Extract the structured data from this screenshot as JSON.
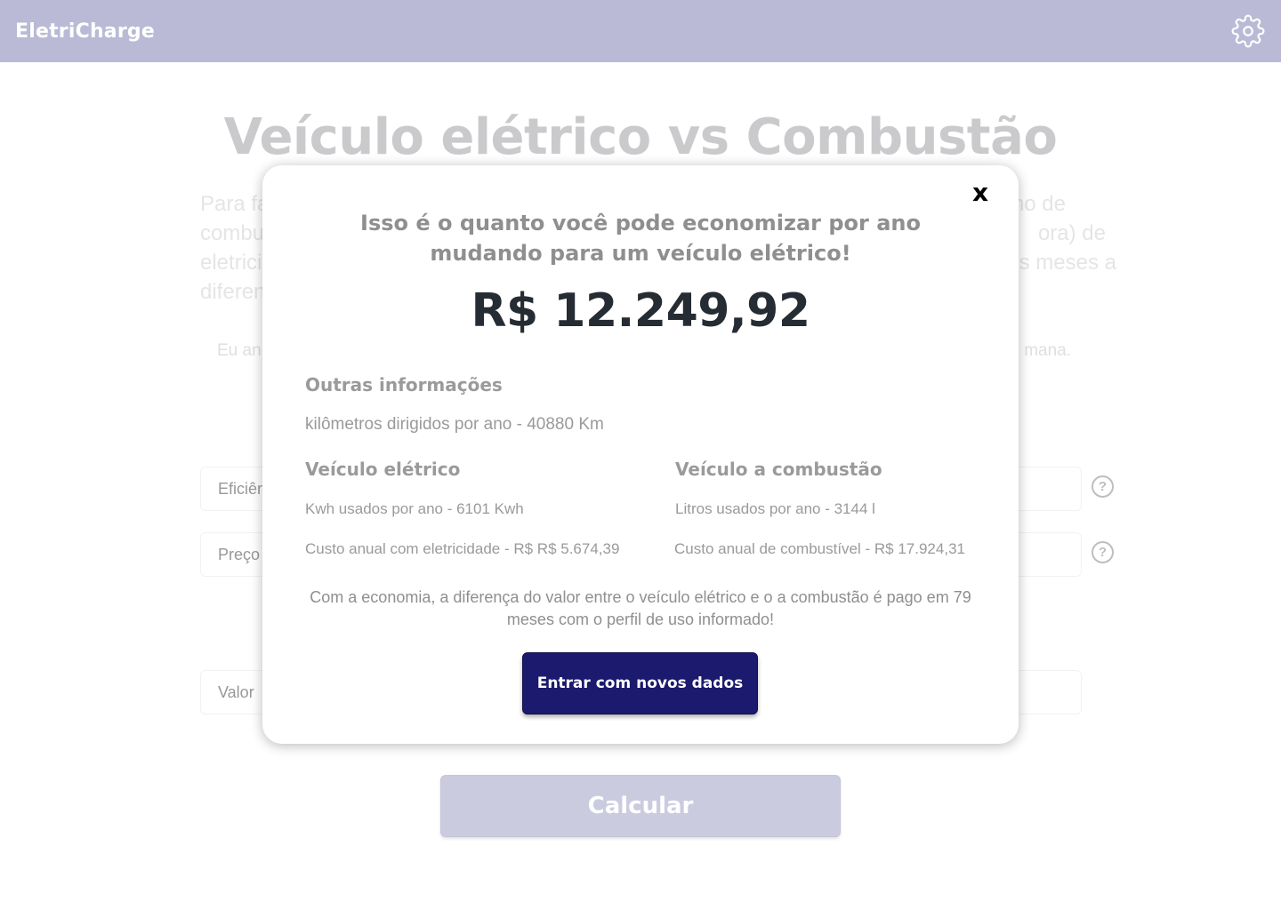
{
  "header": {
    "brand": "EletriCharge",
    "settings_icon": "gear-icon"
  },
  "background": {
    "title": "Veículo elétrico vs Combustão",
    "intro_lines": [
      "Para fa",
      "no de",
      "combu",
      "ora) de",
      "eletrici",
      "s meses a",
      "diferen"
    ],
    "usage_left": "Eu an",
    "usage_right": "mana.",
    "field_efficiency_placeholder": "Eficiên",
    "field_price_placeholder": "Preço",
    "field_value_placeholder": "Valor",
    "help_glyph": "?",
    "calculate_label": "Calcular"
  },
  "modal": {
    "close_label": "x",
    "heading": "Isso é o quanto você pode economizar por ano mudando para um veículo elétrico!",
    "savings": "R$ 12.249,92",
    "other_info_title": "Outras informações",
    "km_per_year": "kilômetros dirigidos por ano - 40880 Km",
    "electric": {
      "title": "Veículo elétrico",
      "usage": "Kwh usados por ano - 6101 Kwh",
      "cost": "Custo anual com eletricidade - R$ R$ 5.674,39"
    },
    "combustion": {
      "title": "Veículo a combustão",
      "usage": "Litros usados por ano - 3144 l",
      "cost": "Custo anual de combustível - R$ 17.924,31"
    },
    "payback": "Com a economia, a diferença do valor entre o veículo elétrico e o a combustão é pago em 79 meses com o perfil de uso informado!",
    "new_data_label": "Entrar com novos dados"
  },
  "colors": {
    "header_bg": "#babad6",
    "primary_button": "#1c1a6e",
    "amount_text": "#252c33"
  }
}
